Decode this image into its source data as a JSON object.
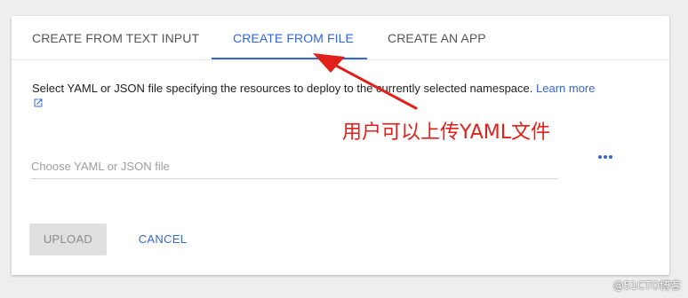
{
  "tabs": [
    {
      "label": "CREATE FROM TEXT INPUT"
    },
    {
      "label": "CREATE FROM FILE"
    },
    {
      "label": "CREATE AN APP"
    }
  ],
  "active_tab": "CREATE FROM FILE",
  "description": "Select YAML or JSON file specifying the resources to deploy to the currently selected namespace.",
  "learn_more_label": "Learn more",
  "file_input": {
    "placeholder": "Choose YAML or JSON file"
  },
  "buttons": {
    "upload": "UPLOAD",
    "cancel": "CANCEL"
  },
  "annotation": {
    "text": "用户可以上传YAML文件"
  },
  "watermark": "@51CTO博客",
  "colors": {
    "accent": "#3367d6",
    "annotation": "#e0201a",
    "background": "#eeeeee"
  }
}
